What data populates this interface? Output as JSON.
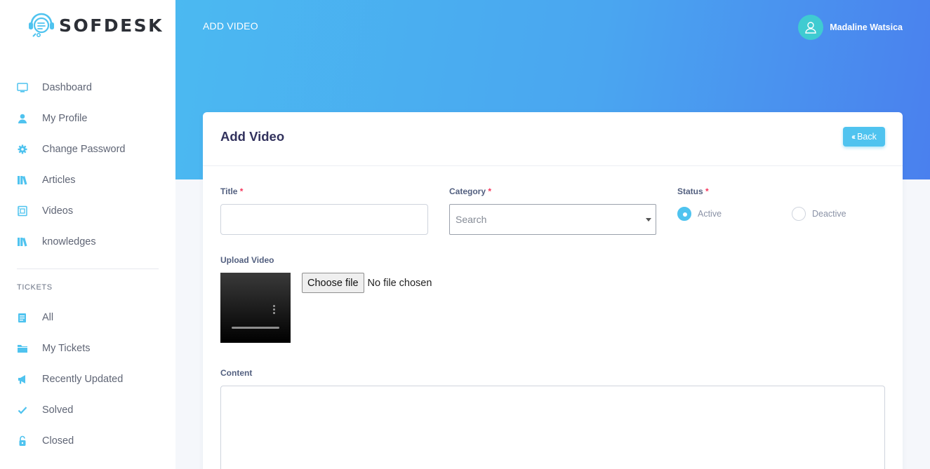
{
  "app": {
    "brand": "SOFDESK"
  },
  "sidebar": {
    "items": [
      {
        "label": "Dashboard",
        "icon": "monitor-icon"
      },
      {
        "label": "My Profile",
        "icon": "user-icon"
      },
      {
        "label": "Change Password",
        "icon": "gear-icon"
      },
      {
        "label": "Articles",
        "icon": "books-icon"
      },
      {
        "label": "Videos",
        "icon": "video-icon"
      },
      {
        "label": "knowledges",
        "icon": "books-icon"
      }
    ],
    "section_label": "TICKETS",
    "tickets": [
      {
        "label": "All",
        "icon": "document-icon"
      },
      {
        "label": "My Tickets",
        "icon": "folder-icon"
      },
      {
        "label": "Recently Updated",
        "icon": "megaphone-icon"
      },
      {
        "label": "Solved",
        "icon": "check-icon"
      },
      {
        "label": "Closed",
        "icon": "lock-icon"
      }
    ]
  },
  "header": {
    "title": "ADD VIDEO",
    "user_name": "Madaline Watsica"
  },
  "card": {
    "title": "Add Video",
    "back_label": "Back",
    "required_mark": "*",
    "fields": {
      "title_label": "Title",
      "title_value": "",
      "category_label": "Category",
      "category_placeholder": "Search",
      "status_label": "Status",
      "status_options": [
        "Active",
        "Deactive"
      ],
      "status_selected": "Active",
      "upload_label": "Upload Video",
      "choose_file_label": "Choose file",
      "file_status": "No file chosen",
      "content_label": "Content",
      "content_value": ""
    }
  },
  "colors": {
    "accent": "#4fc3ef",
    "header_start": "#4bb9f1",
    "header_end": "#4a80ee",
    "avatar": "#3fcbd1",
    "required": "#f5365c"
  }
}
